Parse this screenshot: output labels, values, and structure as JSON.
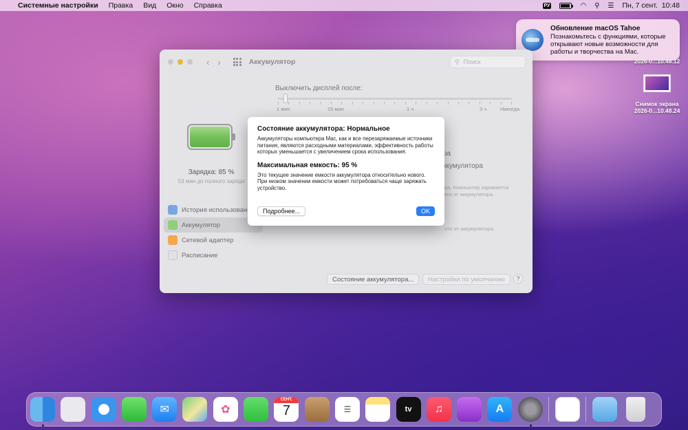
{
  "menubar": {
    "app_name": "Системные настройки",
    "menus": [
      "Правка",
      "Вид",
      "Окно",
      "Справка"
    ],
    "keyboard_layout": "РУ",
    "datetime": "Пн, 7 сент.  10:48"
  },
  "notification": {
    "title": "Обновление macOS Tahoe",
    "body": "Познакомьтесь с функциями, которые открывают новые возможности для работы и творчества на Mac."
  },
  "desktop": {
    "item1_label": "2026-0...10.48.12",
    "item2_name": "Снимок экрана",
    "item2_date": "2026-0...10.48.24"
  },
  "window": {
    "title": "Аккумулятор",
    "search_placeholder": "Поиск",
    "sidebar": {
      "charge_label": "Зарядка: 85 %",
      "charge_sub": "53 мин до полного заряда",
      "items": [
        {
          "label": "История использования",
          "icon": "history-icon"
        },
        {
          "label": "Аккумулятор",
          "icon": "battery-icon"
        },
        {
          "label": "Сетевой адаптер",
          "icon": "power-adapter-icon"
        },
        {
          "label": "Расписание",
          "icon": "calendar-icon"
        }
      ],
      "selected_index": 1
    },
    "content": {
      "display_off_label": "Выключить дисплей после:",
      "tick_labels": [
        "1 мин",
        "15 мин",
        "1 ч",
        "3 ч",
        "Никогда"
      ],
      "opt1_tail": "ра",
      "opt2_tail": "ккумулятора",
      "opt2_desc_a": "ра. Компьютер заряжается",
      "opt2_desc_b": "его от аккумулятора.",
      "opt3_desc": "ото от аккумулятора.",
      "status_button": "Состояние аккумулятора...",
      "defaults_button": "Настройки по умолчанию",
      "help_label": "?"
    }
  },
  "dialog": {
    "heading1": "Состояние аккумулятора: Нормальное",
    "text1": "Аккумуляторы компьютера Mac, как и все перезаряжаемые источники питания, являются расходными материалами, эффективность работы которых уменьшается с увеличением срока использования.",
    "heading2": "Максимальная емкость: 95 %",
    "text2": "Это текущее значение емкости аккумулятора относительно нового. При низком значении емкости может потребоваться чаще заряжать устройство.",
    "more_button": "Подробнее...",
    "ok_button": "OK"
  },
  "dock": {
    "calendar_month": "СЕНТ.",
    "calendar_day": "7",
    "tv_label": "tv"
  },
  "colors": {
    "accent": "#2b7ef4",
    "battery_green": "#74c05a"
  }
}
